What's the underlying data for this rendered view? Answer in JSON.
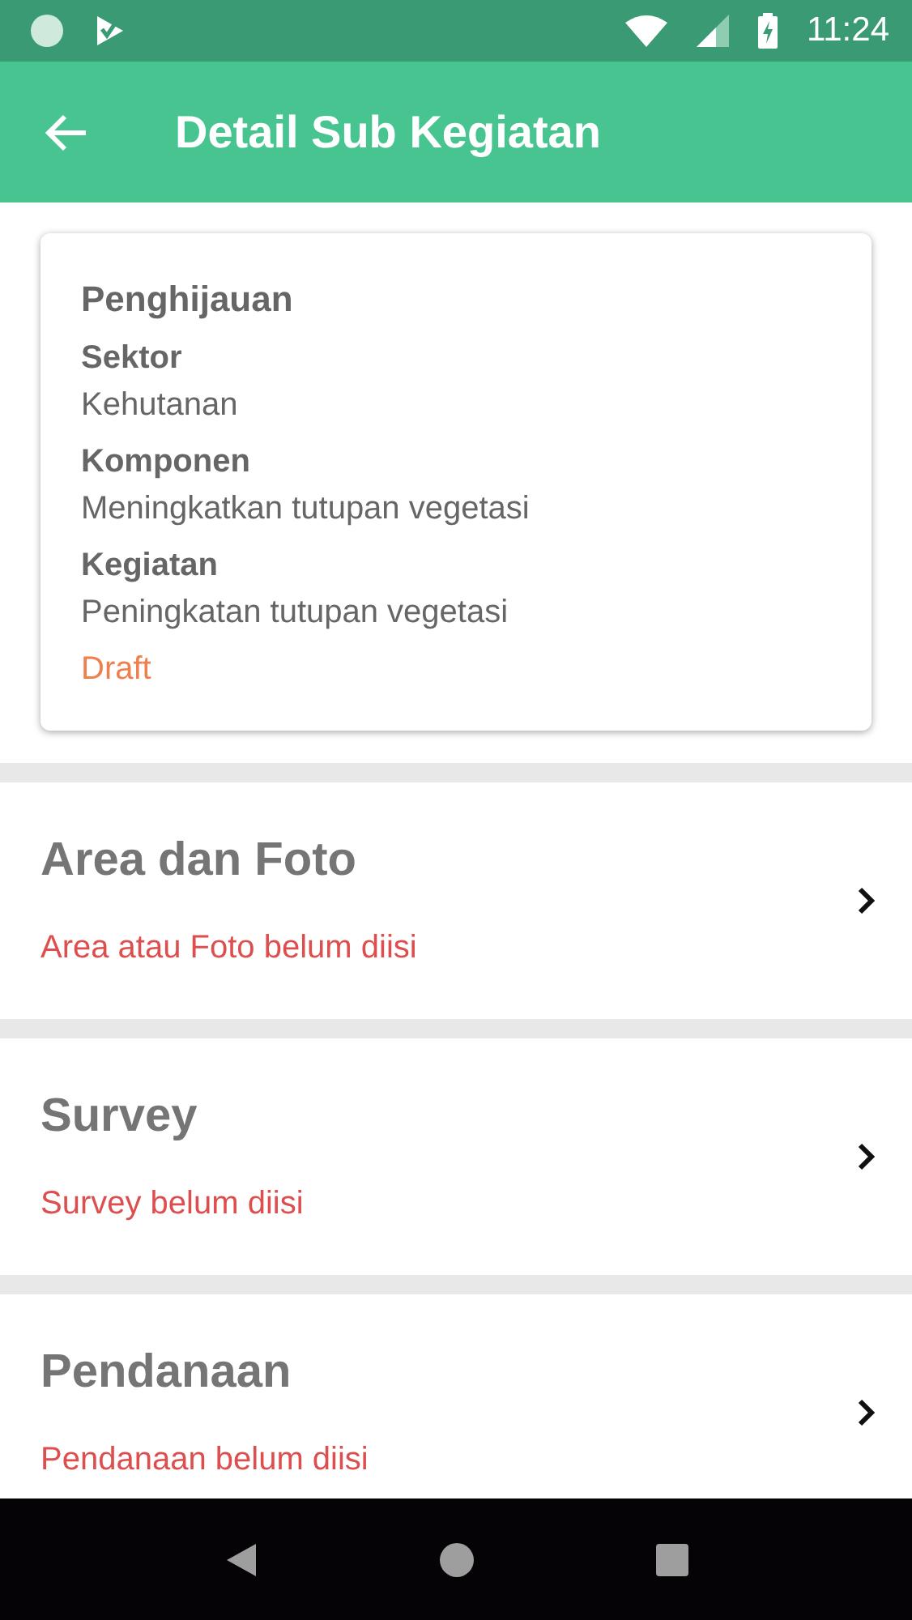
{
  "status_bar": {
    "time": "11:24"
  },
  "app_bar": {
    "title": "Detail Sub Kegiatan"
  },
  "card": {
    "title": "Penghijauan",
    "fields": [
      {
        "label": "Sektor",
        "value": "Kehutanan"
      },
      {
        "label": "Komponen",
        "value": "Meningkatkan tutupan vegetasi"
      },
      {
        "label": "Kegiatan",
        "value": "Peningkatan tutupan vegetasi"
      }
    ],
    "status": "Draft"
  },
  "sections": [
    {
      "title": "Area dan Foto",
      "note": "Area atau Foto belum diisi"
    },
    {
      "title": "Survey",
      "note": "Survey belum diisi"
    },
    {
      "title": "Pendanaan",
      "note": "Pendanaan belum diisi"
    }
  ]
}
